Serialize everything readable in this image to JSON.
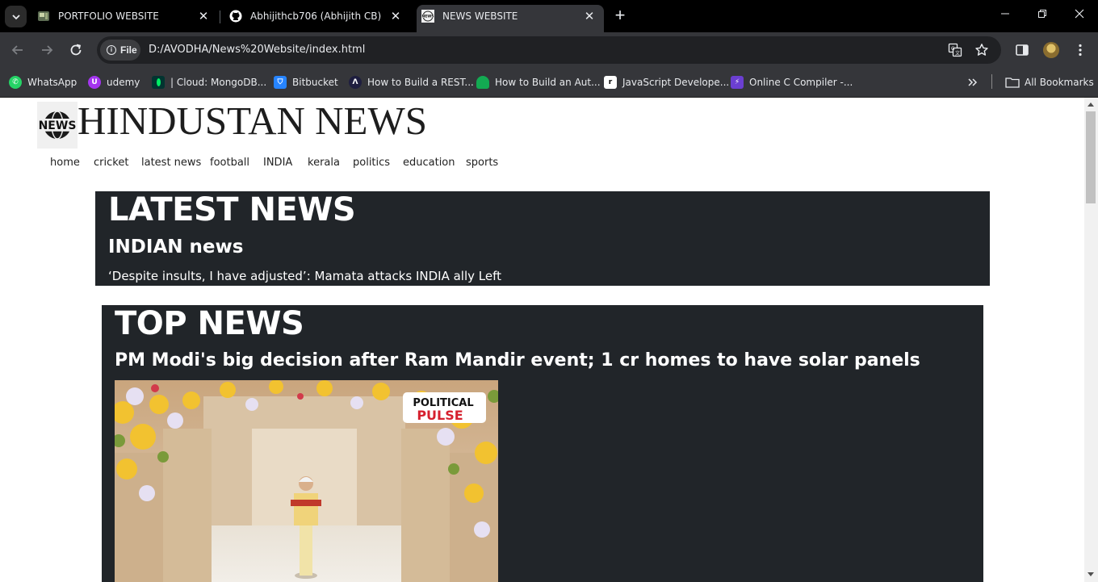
{
  "browser": {
    "tabs": [
      {
        "title": "PORTFOLIO WEBSITE",
        "active": false
      },
      {
        "title": "Abhijithcb706 (Abhijith CB)",
        "active": false
      },
      {
        "title": "NEWS WEBSITE",
        "active": true
      }
    ],
    "address": {
      "scheme_chip": "File",
      "url": "D:/AVODHA/News%20Website/index.html"
    },
    "bookmarks": [
      {
        "label": "WhatsApp",
        "color": "#25d366"
      },
      {
        "label": "udemy",
        "color": "#a435f0"
      },
      {
        "label": "| Cloud: MongoDB...",
        "color": "#00684a"
      },
      {
        "label": "Bitbucket",
        "color": "#2684ff"
      },
      {
        "label": "How to Build a REST...",
        "color": "#1e1e3f"
      },
      {
        "label": "How to Build an Aut...",
        "color": "#13aa52"
      },
      {
        "label": "JavaScript Develope...",
        "color": "#000000"
      },
      {
        "label": "Online C Compiler -...",
        "color": "#6b3fd1"
      }
    ],
    "all_bookmarks_label": "All Bookmarks"
  },
  "site": {
    "logo_text": "NEWS",
    "title": "HINDUSTAN NEWS",
    "nav": [
      "home",
      "cricket",
      "latest news",
      "football",
      "INDIA",
      "kerala",
      "politics",
      "education",
      "sports"
    ]
  },
  "latest": {
    "heading": "LATEST NEWS",
    "subheading": "INDIAN news",
    "headline": "‘Despite insults, I have adjusted’: Mamata attacks INDIA ally Left"
  },
  "top": {
    "heading": "TOP NEWS",
    "headline": "PM Modi's big decision after Ram Mandir event; 1 cr homes to have solar panels",
    "image_badge_line1": "POLITICAL",
    "image_badge_line2": "PULSE"
  }
}
